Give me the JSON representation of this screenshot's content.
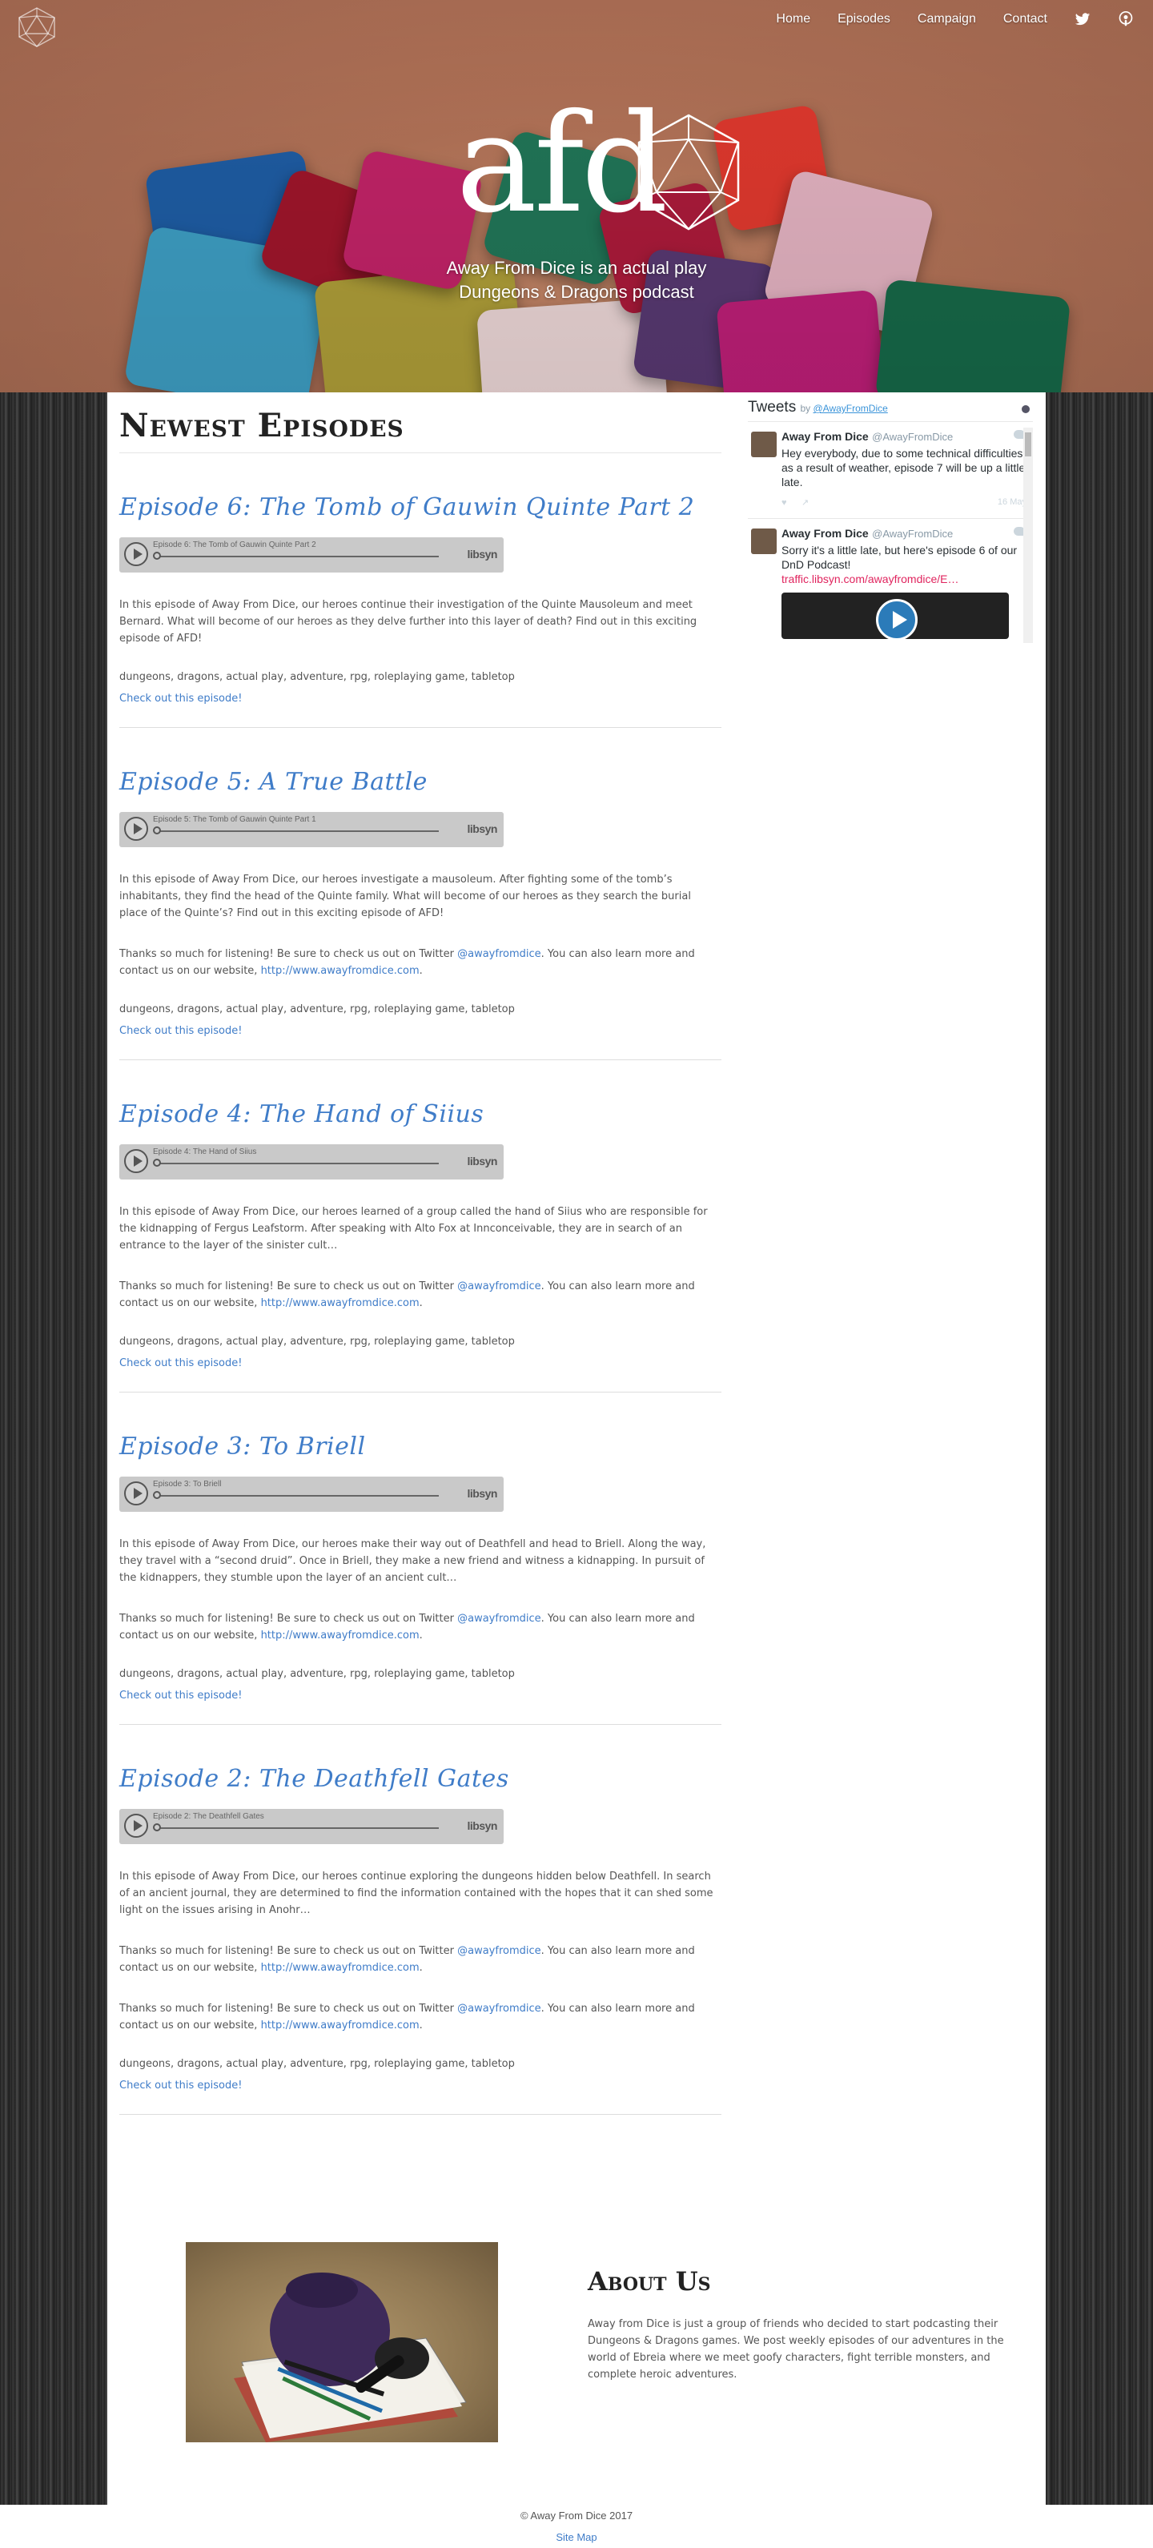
{
  "nav": {
    "items": [
      "Home",
      "Episodes",
      "Campaign",
      "Contact"
    ],
    "social_icons": [
      "twitter-icon",
      "podcast-icon"
    ]
  },
  "hero": {
    "logo": "afd",
    "tagline_line1": "Away From Dice is an actual play",
    "tagline_line2": "Dungeons & Dragons podcast"
  },
  "main": {
    "section_title": "Newest Episodes",
    "player_brand": "libsyn",
    "episodes": [
      {
        "title": "Episode 6: The Tomb of Gauwin Quinte Part 2",
        "player_title": "Episode 6: The Tomb of Gauwin Quinte Part 2",
        "description": "In this episode of Away From Dice, our heroes continue their investigation of the Quinte Mausoleum and meet Bernard.  What will become of our heroes as they delve further into this layer of death? Find out in this exciting episode of AFD!",
        "tags": "dungeons, dragons, actual play, adventure, rpg, roleplaying game, tabletop",
        "link": "Check out this episode!"
      },
      {
        "title": "Episode 5: A True Battle",
        "player_title": "Episode 5: The Tomb of Gauwin Quinte Part 1",
        "description": "In this episode of Away From Dice, our heroes investigate a mausoleum. After fighting some of the tomb’s inhabitants, they find the head of the Quinte family. What will become of our heroes as they search the burial place of the Quinte’s? Find out in this exciting episode of AFD!",
        "thanks_pre": "Thanks so much for listening! Be sure to check us out on Twitter ",
        "thanks_handle": "@awayfromdice",
        "thanks_mid": ". You can also learn more and contact us on our website, ",
        "thanks_url": "http://www.awayfromdice.com",
        "thanks_end": ".",
        "tags": "dungeons, dragons, actual play, adventure, rpg, roleplaying game, tabletop",
        "link": "Check out this episode!"
      },
      {
        "title": "Episode 4: The Hand of Siius",
        "player_title": "Episode 4: The Hand of Siius",
        "description": "In this episode of Away From Dice, our heroes learned of a group called the hand of Siius who are responsible for the kidnapping of Fergus Leafstorm. After speaking with Alto Fox at Innconceivable, they are in search of an entrance to the layer of the sinister cult…",
        "thanks_pre": "Thanks so much for listening! Be sure to check us out on Twitter ",
        "thanks_handle": "@awayfromdice",
        "thanks_mid": ". You can also learn more and contact us on our website, ",
        "thanks_url": "http://www.awayfromdice.com",
        "thanks_end": ".",
        "tags": "dungeons, dragons, actual play, adventure, rpg, roleplaying game, tabletop",
        "link": "Check out this episode!"
      },
      {
        "title": "Episode 3: To Briell",
        "player_title": "Episode 3: To Briell",
        "description": "In this episode of Away From Dice, our heroes make their way out of Deathfell and head to Briell. Along the way, they travel with a “second druid”. Once in Briell, they make a new friend and witness a kidnapping. In pursuit of the kidnappers, they stumble upon the layer of an ancient cult…",
        "thanks_pre": "Thanks so much for listening! Be sure to check us out on Twitter ",
        "thanks_handle": "@awayfromdice",
        "thanks_mid": ". You can also learn more and contact us on our website, ",
        "thanks_url": "http://www.awayfromdice.com",
        "thanks_end": ".",
        "tags": "dungeons, dragons, actual play, adventure, rpg, roleplaying game, tabletop",
        "link": "Check out this episode!"
      },
      {
        "title": "Episode 2: The Deathfell Gates",
        "player_title": "Episode 2: The Deathfell Gates",
        "description": "In this episode of Away From Dice, our heroes continue exploring the dungeons hidden below Deathfell. In search of an ancient journal, they are determined to find the information contained with the hopes that it can shed some light on the issues arising in Anohr…",
        "thanks_pre": "Thanks so much for listening! Be sure to check us out on Twitter ",
        "thanks_handle": "@awayfromdice",
        "thanks_mid": ". You can also learn more and contact us on our website, ",
        "thanks_url": "http://www.awayfromdice.com",
        "thanks_end": ".",
        "tags": "dungeons, dragons, actual play, adventure, rpg, roleplaying game, tabletop",
        "link": "Check out this episode!"
      }
    ]
  },
  "twitter": {
    "title": "Tweets",
    "by": "by ",
    "by_handle": "@AwayFromDice",
    "tweets": [
      {
        "name": "Away From Dice",
        "handle": "@AwayFromDice",
        "text": "Hey everybody, due to some technical difficulties as a result of weather, episode 7 will be up a little late.",
        "date": "16 May"
      },
      {
        "name": "Away From Dice",
        "handle": "@AwayFromDice",
        "text": "Sorry it's a little late, but here's episode 6 of our DnD Podcast!",
        "link": "traffic.libsyn.com/awayfromdice/E…"
      }
    ]
  },
  "about": {
    "title": "About Us",
    "text": "Away from Dice is just a group of friends who decided to start podcasting their Dungeons & Dragons games. We post weekly episodes of our adventures in the world of Ebreia where we meet goofy characters, fight terrible monsters, and complete heroic adventures."
  },
  "footer": {
    "copyright": "© Away From Dice 2017",
    "sitemap": "Site Map"
  },
  "colors": {
    "accent": "#3f7cc8",
    "twitter_link": "#3b94d9",
    "tweet_link": "#e0245e"
  }
}
